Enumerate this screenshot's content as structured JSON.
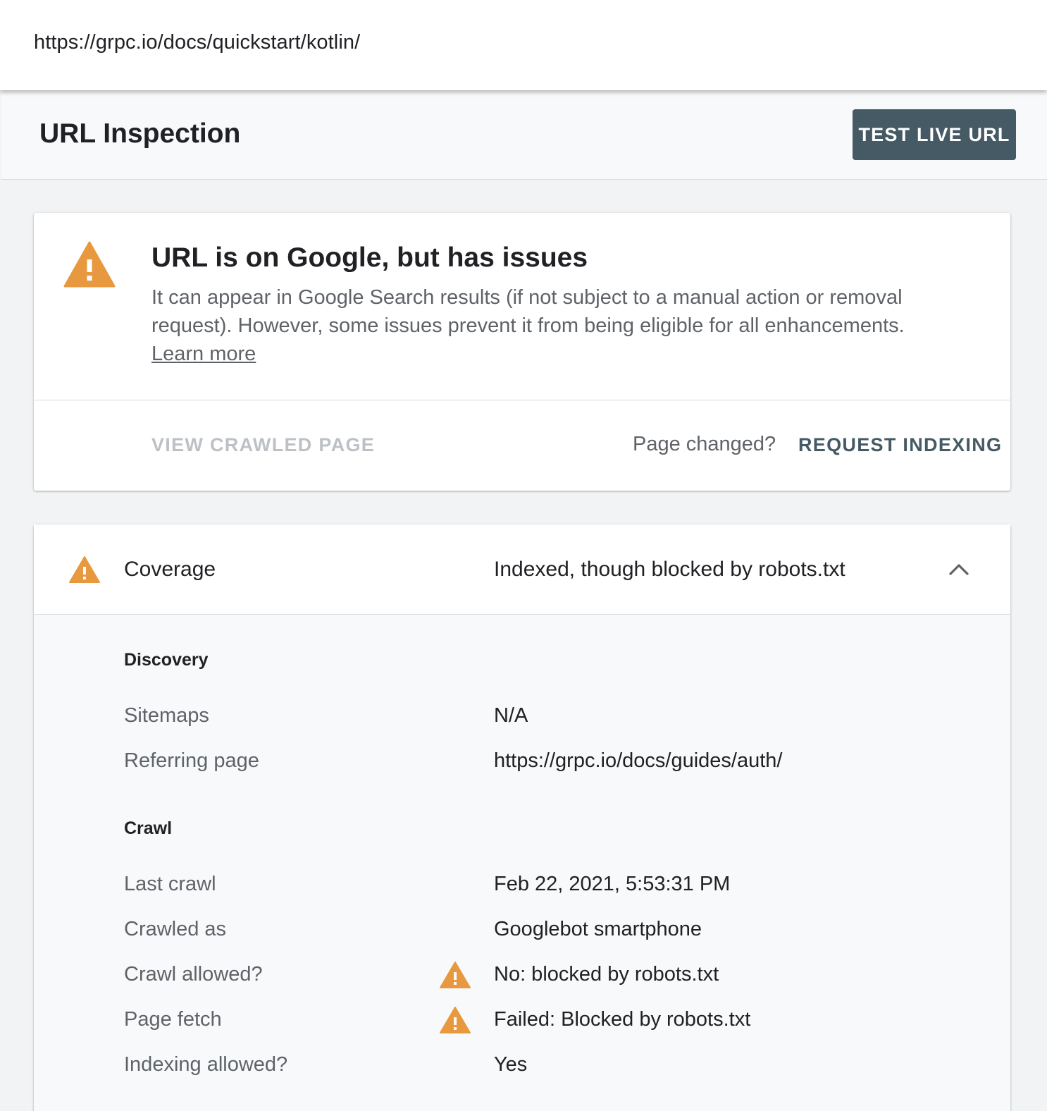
{
  "url_bar": {
    "url": "https://grpc.io/docs/quickstart/kotlin/"
  },
  "header": {
    "title": "URL Inspection",
    "test_live_url_label": "TEST LIVE URL"
  },
  "status_card": {
    "title": "URL is on Google, but has issues",
    "description": "It can appear in Google Search results (if not subject to a manual action or removal request). However, some issues prevent it from being eligible for all enhancements.",
    "learn_more": "Learn more",
    "view_crawled_page": "VIEW CRAWLED PAGE",
    "page_changed": "Page changed?",
    "request_indexing": "REQUEST INDEXING"
  },
  "coverage": {
    "label": "Coverage",
    "value": "Indexed, though blocked by robots.txt",
    "sections": [
      {
        "heading": "Discovery",
        "rows": [
          {
            "label": "Sitemaps",
            "value": "N/A",
            "warning": false
          },
          {
            "label": "Referring page",
            "value": "https://grpc.io/docs/guides/auth/",
            "warning": false
          }
        ]
      },
      {
        "heading": "Crawl",
        "rows": [
          {
            "label": "Last crawl",
            "value": "Feb 22, 2021, 5:53:31 PM",
            "warning": false
          },
          {
            "label": "Crawled as",
            "value": "Googlebot smartphone",
            "warning": false
          },
          {
            "label": "Crawl allowed?",
            "value": "No: blocked by robots.txt",
            "warning": true
          },
          {
            "label": "Page fetch",
            "value": "Failed: Blocked by robots.txt",
            "warning": true
          },
          {
            "label": "Indexing allowed?",
            "value": "Yes",
            "warning": false
          }
        ]
      }
    ]
  },
  "colors": {
    "warning": "#e8983e",
    "button_bg": "#455a64",
    "secondary_text": "#5f6368",
    "disabled_text": "#bdc1c6"
  },
  "icons": {
    "status": "warning-triangle-icon",
    "coverage": "warning-triangle-icon",
    "expand": "chevron-up-icon"
  }
}
